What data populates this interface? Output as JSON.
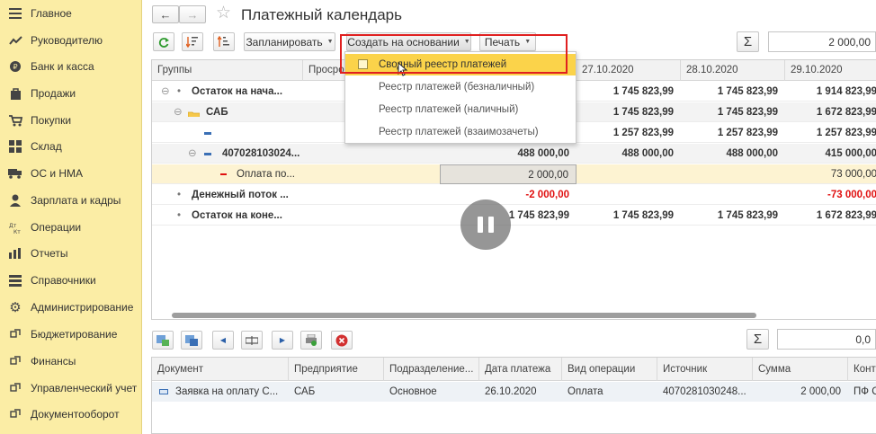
{
  "sidebar": {
    "items": [
      {
        "label": "Главное",
        "icon": "menu-icon"
      },
      {
        "label": "Руководителю",
        "icon": "trend-icon"
      },
      {
        "label": "Банк и касса",
        "icon": "coin-icon"
      },
      {
        "label": "Продажи",
        "icon": "bag-icon"
      },
      {
        "label": "Покупки",
        "icon": "cart-icon"
      },
      {
        "label": "Склад",
        "icon": "warehouse-icon"
      },
      {
        "label": "ОС и НМА",
        "icon": "truck-icon"
      },
      {
        "label": "Зарплата и кадры",
        "icon": "person-icon"
      },
      {
        "label": "Операции",
        "icon": "dt-kt-icon"
      },
      {
        "label": "Отчеты",
        "icon": "bar-chart-icon"
      },
      {
        "label": "Справочники",
        "icon": "book-icon"
      },
      {
        "label": "Администрирование",
        "icon": "gear-icon"
      },
      {
        "label": "Бюджетирование",
        "icon": "link-icon"
      },
      {
        "label": "Финансы",
        "icon": "link-icon"
      },
      {
        "label": "Управленческий учет",
        "icon": "link-icon"
      },
      {
        "label": "Документооборот",
        "icon": "link-icon"
      }
    ]
  },
  "header": {
    "back": "←",
    "forward": "→",
    "title": "Платежный календарь"
  },
  "toolbar": {
    "plan_label": "Запланировать",
    "create_label": "Создать на основании",
    "print_label": "Печать",
    "sigma": "Σ",
    "total_value": "2 000,00"
  },
  "grid": {
    "headers": [
      "Группы",
      "Просро",
      "",
      "27.10.2020",
      "28.10.2020",
      "29.10.2020"
    ],
    "rows": [
      {
        "label": "Остаток на нача...",
        "c1": "",
        "c2": "1 745 823,99",
        "c3": "1 745 823,99",
        "c4": "1 914 823,99"
      },
      {
        "label": "САБ",
        "c1": "",
        "c2": "1 745 823,99",
        "c3": "1 745 823,99",
        "c4": "1 672 823,99"
      },
      {
        "label": "",
        "c1": "",
        "c2": "1 257 823,99",
        "c3": "1 257 823,99",
        "c4": "1 257 823,99"
      },
      {
        "label": "407028103024...",
        "c1": "488 000,00",
        "c2": "488 000,00",
        "c3": "488 000,00",
        "c4": "415 000,00"
      },
      {
        "label": "Оплата по...",
        "c1": "2 000,00",
        "c2": "",
        "c3": "",
        "c4": "73 000,00"
      },
      {
        "label": "Денежный поток ...",
        "c1": "-2 000,00",
        "c2": "",
        "c3": "",
        "c4": "-73 000,00"
      },
      {
        "label": "Остаток на коне...",
        "c1": "1 745 823,99",
        "c2": "1 745 823,99",
        "c3": "1 745 823,99",
        "c4": "1 672 823,99"
      }
    ]
  },
  "menu": {
    "items": [
      "Сводный реестр платежей",
      "Реестр платежей (безналичный)",
      "Реестр платежей (наличный)",
      "Реестр платежей (взаимозачеты)"
    ]
  },
  "lower": {
    "sigma": "Σ",
    "total_value": "0,0",
    "headers": [
      "Документ",
      "Предприятие",
      "Подразделение...",
      "Дата платежа",
      "Вид операции",
      "Источник",
      "Сумма",
      "Контр"
    ],
    "row": {
      "document": "Заявка на оплату С...",
      "company": "САБ",
      "department": "Основное",
      "date": "26.10.2020",
      "operation": "Оплата",
      "source": "4070281030248...",
      "amount": "2 000,00",
      "counterparty": "ПФ С"
    }
  },
  "colors": {
    "sidebar": "#fbeda5",
    "menu_highlight": "#fbd34a",
    "negative": "#e01010",
    "frame": "#e02020"
  }
}
